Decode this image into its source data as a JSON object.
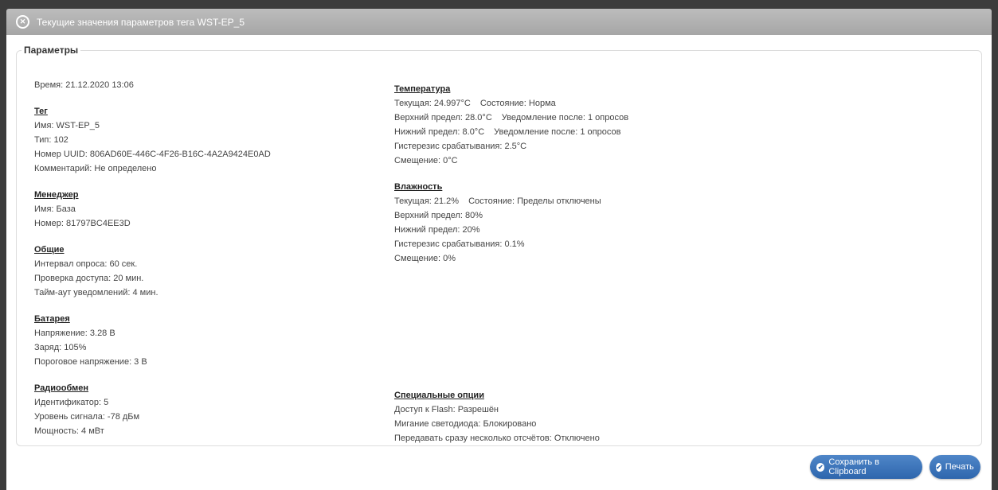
{
  "dialog": {
    "title": "Текущие значения параметров тега WST-EP_5",
    "fieldset_legend": "Параметры"
  },
  "left": {
    "time": "Время: 21.12.2020 13:06",
    "tag": {
      "title": "Тег",
      "name": "Имя: WST-EP_5",
      "type": "Тип: 102",
      "uuid": "Номер UUID: 806AD60E-446C-4F26-B16C-4A2A9424E0AD",
      "comment": "Комментарий: Не определено"
    },
    "manager": {
      "title": "Менеджер",
      "name": "Имя: База",
      "number": "Номер: 81797BC4EE3D"
    },
    "general": {
      "title": "Общие",
      "poll_interval": "Интервал опроса: 60 сек.",
      "access_check": "Проверка доступа: 20 мин.",
      "notify_timeout": "Тайм-аут уведомлений: 4 мин."
    },
    "battery": {
      "title": "Батарея",
      "voltage": "Напряжение: 3.28 В",
      "charge": "Заряд: 105%",
      "threshold": "Пороговое напряжение: 3 В"
    },
    "radio": {
      "title": "Радиообмен",
      "id": "Идентификатор: 5",
      "signal": "Уровень сигнала: -78 дБм",
      "power": "Мощность: 4 мВт"
    }
  },
  "right": {
    "temperature": {
      "title": "Температура",
      "current": "Текущая: 24.997°C",
      "state": "Состояние: Норма",
      "upper": "Верхний предел: 28.0°C",
      "upper_notify": "Уведомление после: 1 опросов",
      "lower": "Нижний предел: 8.0°C",
      "lower_notify": "Уведомление после: 1 опросов",
      "hysteresis": "Гистерезис срабатывания: 2.5°C",
      "offset": "Смещение: 0°C"
    },
    "humidity": {
      "title": "Влажность",
      "current": "Текущая: 21.2%",
      "state": "Состояние: Пределы отключены",
      "upper": "Верхний предел: 80%",
      "lower": "Нижний предел: 20%",
      "hysteresis": "Гистерезис срабатывания: 0.1%",
      "offset": "Смещение: 0%"
    },
    "special": {
      "title": "Специальные опции",
      "flash": "Доступ к Flash: Разрешён",
      "led": "Мигание светодиода: Блокировано",
      "multi": "Передавать сразу несколько отсчётов: Отключено"
    }
  },
  "buttons": {
    "clipboard": "Сохранить в Clipboard",
    "print": "Печать"
  },
  "icons": {
    "close": "close-circle-icon",
    "check": "check-circle-icon"
  }
}
